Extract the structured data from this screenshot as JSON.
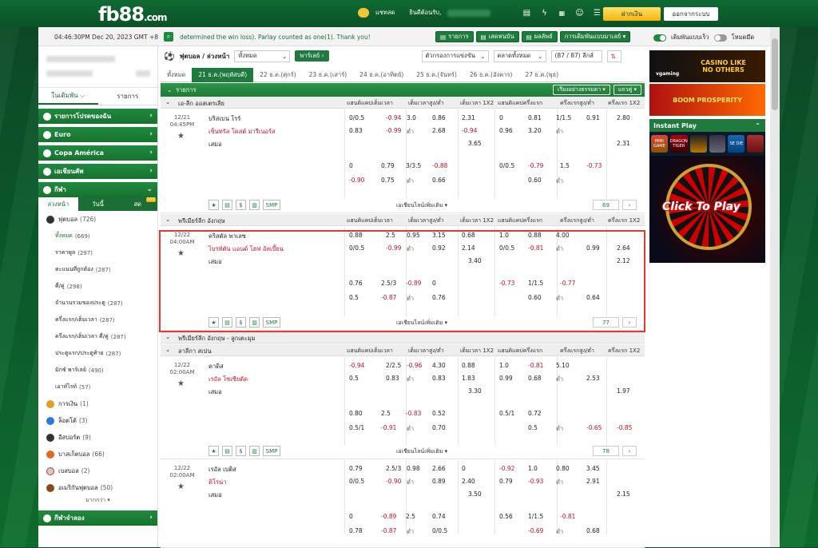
{
  "brand": {
    "logo_main": "fb88",
    "logo_suffix": ".com"
  },
  "topbar": {
    "chat_label": "แชทสด",
    "welcome": "ยินดีต้อนรับ,",
    "deposit_label": "ฝากเงิน",
    "logout_label": "ออกจากระบบ",
    "icons": [
      "chat-icon",
      "wallet-icon",
      "bolt-icon",
      "cards-icon",
      "user-icon",
      "menu-icon"
    ]
  },
  "infobar": {
    "clock": "04:46:30PM Dec 20, 2023 GMT +8",
    "marquee": "determined the win loss). Parlay counted as one(1). Thank you!",
    "buttons": [
      "รายการ",
      "เสดหนบัน",
      "ผลลัพธ์",
      "การเดิมพันแบบมาเลย์ ▾"
    ],
    "toggle1": "เดิมพันแบบเร็ว",
    "toggle2": "โหมดมืด"
  },
  "sidebar": {
    "tab1": "ในเดิมพัน",
    "tab2": "รายการ",
    "groups": [
      {
        "label": "รายการโปรดของฉัน"
      },
      {
        "label": "Euro"
      },
      {
        "label": "Copa América"
      },
      {
        "label": "เอเชียนคัพ"
      },
      {
        "label": "กีฬา"
      }
    ],
    "subtabs": [
      "ล่วงหน้า",
      "วันนี้",
      "สด"
    ],
    "live_badge": "100",
    "items": [
      {
        "label": "ฟุตบอล",
        "count": "(726)"
      },
      {
        "label": "ทั้งหมด",
        "count": "(669)"
      },
      {
        "label": "ราคาพูล",
        "count": "(297)"
      },
      {
        "label": "คะแนนที่ถูกต้อง",
        "count": "(287)"
      },
      {
        "label": "คี่/คู่",
        "count": "(298)"
      },
      {
        "label": "จำนวนรวมของประตู",
        "count": "(287)"
      },
      {
        "label": "ครึ่งแรก/เต็มเวลา",
        "count": "(287)"
      },
      {
        "label": "ครึ่งแรก/เต็มเวลา คี่/คู่",
        "count": "(287)"
      },
      {
        "label": "ประตูแรก/ประตูท้าย",
        "count": "(287)"
      },
      {
        "label": "มิกซ์ พาร์เลย์",
        "count": "(490)"
      },
      {
        "label": "เอาท์ไรท์",
        "count": "(57)"
      },
      {
        "label": "การเงิน",
        "count": "(1)"
      },
      {
        "label": "ล็อตโต้",
        "count": "(3)"
      },
      {
        "label": "อีสปอร์ต",
        "count": "(9)"
      },
      {
        "label": "บาสเก็ตบอล",
        "count": "(66)"
      },
      {
        "label": "เบสบอล",
        "count": "(2)"
      },
      {
        "label": "อเมริกันฟุตบอล",
        "count": "(50)"
      }
    ],
    "more": "มากกว่า ▾",
    "virtual": "กีฬาจำลอง"
  },
  "content": {
    "sport_title": "ฟุตบอล / ล่วงหน้า",
    "sport_select": "ทั้งหมด",
    "parlay": "พาร์เลย์ ›",
    "filter1": "ตัวกรองการแข่งขัน",
    "filter2": "ตลาดทั้งหมด",
    "league_count": "(87 / 87) ลีกส์",
    "date_tabs": [
      "ทั้งหมด",
      "21 ธ.ค.(พฤหัสบดี)",
      "22 ธ.ค.(ศุกร์)",
      "23 ธ.ค.(เสาร์)",
      "24 ธ.ค.(อาทิตย์)",
      "25 ธ.ค.(จันทร์)",
      "26 ธ.ค.(อังคาร)",
      "27 ธ.ค.(พุธ)"
    ],
    "list_label": "รายการ",
    "sort_label": "เรียงอย่างธรรมดา ▾",
    "view_label": "แถวคู่ ▾",
    "col_headers": [
      "แฮนดิแคปเต็มเวลา",
      "เต็มเวลาสูง/ต่ำ",
      "เต็มเวลา 1X2",
      "แฮนดิแคปครึ่งแรก",
      "ครึ่งแรกสูง/ต่ำ",
      "ครึ่งแรก 1X2"
    ],
    "under_label": "ต่ำ",
    "more_lines": "เอเชียนไลน์เพิ่มเติม ▾",
    "smp": "SMP",
    "leagues": [
      {
        "name": "เอ-ลีก ออสเตรเลีย"
      },
      {
        "name": "พรีเมียร์ลีก อังกฤษ"
      },
      {
        "name": "พรีเมียร์ลีก อังกฤษ - ลูกเตะมุม"
      },
      {
        "name": "ลาลีกา สเปน"
      }
    ],
    "matches": [
      {
        "date": "12/21",
        "time": "04:45PM",
        "home": "บริสเบน โรร์",
        "away": "เซ็นทรัล โคสต์ มารีเนอร์ส",
        "draw": "เสมอ",
        "more_count": "69",
        "r1": [
          "0/0.5",
          "-0.94",
          "3.0",
          "0.86",
          "2.31",
          "0",
          "0.81",
          "1/1.5",
          "0.91",
          "2.80"
        ],
        "r2": [
          "0.83",
          "-0.99",
          "2.68",
          "-0.94",
          "0.96",
          "3.20"
        ],
        "r3": [
          "3.65",
          "2.31"
        ],
        "r4": [
          "0",
          "0.79",
          "3/3.5",
          "-0.88",
          "0/0.5",
          "-0.79",
          "1.5",
          "-0.73"
        ],
        "r5": [
          "-0.90",
          "0.75",
          "0.66",
          "0.60"
        ]
      },
      {
        "date": "12/22",
        "time": "04:00AM",
        "home": "คริสตัล พาเลซ",
        "away": "ไบรท์ตัน แอนด์ โฮฟ อัลเบี้ยน",
        "draw": "เสมอ",
        "more_count": "77",
        "r1": [
          "0.88",
          "2.5",
          "0.95",
          "3.15",
          "0.68",
          "1.0",
          "0.88",
          "4.00"
        ],
        "r2": [
          "0/0.5",
          "-0.99",
          "0.92",
          "2.14",
          "0/0.5",
          "-0.81",
          "0.99",
          "2.64"
        ],
        "r3": [
          "3.40",
          "2.12"
        ],
        "r4": [
          "0.76",
          "2.5/3",
          "-0.89",
          "0",
          "-0.73",
          "1/1.5",
          "-0.77"
        ],
        "r5": [
          "0.5",
          "-0.87",
          "0.76",
          "0.60",
          "0.64"
        ]
      },
      {
        "date": "12/22",
        "time": "02:00AM",
        "home": "คาดิส",
        "away": "เรอัล โซเซียดัด",
        "draw": "เสมอ",
        "more_count": "78",
        "r1": [
          "-0.94",
          "2/2.5",
          "-0.96",
          "4.30",
          "0.88",
          "1.0",
          "-0.81",
          "5.10"
        ],
        "r2": [
          "0.5",
          "0.83",
          "0.83",
          "1.83",
          "0.99",
          "0.68",
          "2.53"
        ],
        "r3": [
          "3.30",
          "1.97"
        ],
        "r4": [
          "0.80",
          "2.5",
          "-0.83",
          "0.52",
          "0.5/1",
          "0.72"
        ],
        "r5": [
          "0.5/1",
          "-0.91",
          "0.70",
          "0.5",
          "-0.65",
          "-0.85"
        ]
      },
      {
        "date": "12/22",
        "time": "02:00AM",
        "home": "เรอัล เบติส",
        "away": "คิโรน่า",
        "draw": "เสมอ",
        "r1": [
          "0.79",
          "2.5/3",
          "0.98",
          "2.66",
          "0",
          "-0.92",
          "1.0",
          "0.80",
          "3.45"
        ],
        "r2": [
          "0/0.5",
          "-0.90",
          "0.89",
          "2.40",
          "0.79",
          "-0.93",
          "2.91"
        ],
        "r3": [
          "3.50",
          "2.15"
        ],
        "r4": [
          "0",
          "-0.89",
          "2.5",
          "0.74",
          "0.56",
          "1/1.5",
          "-0.81"
        ],
        "r5": [
          "0.78",
          "-0.87",
          "0/0.5",
          "-0.69",
          "0.68"
        ]
      }
    ]
  },
  "rail": {
    "banner1": "CASINO LIKE NO OTHERS",
    "banner1_brand": "vgaming",
    "banner2": "BOOM PROSPERITY",
    "instant_play": "Instant Play",
    "games": [
      "MINI GAME",
      "DRAGON TIGER",
      "",
      "",
      "SE DIE",
      ""
    ],
    "click_to_play": "Click To Play"
  }
}
